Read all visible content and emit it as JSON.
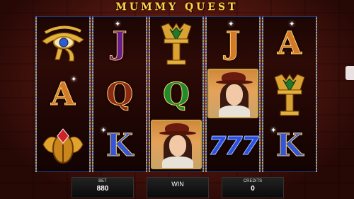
{
  "game": {
    "title": "MUMMY QUEST"
  },
  "reels": [
    [
      "eye-of-horus",
      "A",
      "scarab"
    ],
    [
      "J",
      "Q",
      "K"
    ],
    [
      "lotus-amulet",
      "Q",
      "explorer-woman"
    ],
    [
      "J",
      "explorer-woman",
      "777"
    ],
    [
      "A",
      "lotus-amulet",
      "K"
    ]
  ],
  "symbol_text": {
    "A": "A",
    "J": "J",
    "Q": "Q",
    "K": "K",
    "777": "777"
  },
  "panels": {
    "bet_label": "BET",
    "bet_value": "880",
    "win_label": "WIN",
    "credits_label": "CREDITS",
    "credits_value": "0"
  },
  "colors": {
    "title_gold": "#ffd34a",
    "reel_border_blue": "#3a6ad8",
    "background_red": "#5a1a12"
  }
}
